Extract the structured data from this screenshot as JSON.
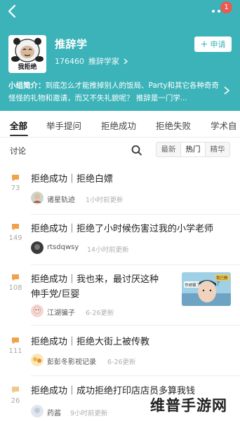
{
  "header": {
    "group_name": "推辞学",
    "member_count": "176460",
    "member_label": "推辞学家",
    "join_label": "申请",
    "avatar_caption": "我拒绝",
    "notification_count": "1",
    "intro_label": "小组简介：",
    "intro_text": "到底怎么才能推掉别人的饭局、Party和其它各种奇奇怪怪的礼物和邀请，而又不失礼貌呢？ 推辞是一门学...",
    "colors": {
      "brand": "#3cb3b9",
      "badge": "#e95a52"
    }
  },
  "tabs": [
    "全部",
    "举手提问",
    "拒绝成功",
    "拒绝失败",
    "学术自"
  ],
  "toolbar": {
    "title": "讨论",
    "sort_options": [
      "最新",
      "热门",
      "精华"
    ],
    "active_sort": "热门"
  },
  "posts": [
    {
      "replies": "73",
      "title_lines": [
        "拒绝成功｜拒绝白嫖"
      ],
      "author": "诸星轨迹",
      "time": "1小时前更新"
    },
    {
      "replies": "149",
      "title_lines": [
        "拒绝成功｜拒绝了小时候伤害过我的小学老师"
      ],
      "author": "rtsdqwsy",
      "time": "14小时前更新"
    },
    {
      "replies": "108",
      "title_lines": [
        "拒绝成功｜我也来，最讨厌这种",
        "伸手党/巨婴"
      ],
      "author": "江湖骗子",
      "time": "6-26更新",
      "thumb_labels": [
        "你被骗了",
        "我已删了"
      ]
    },
    {
      "replies": "111",
      "title_lines": [
        "拒绝成功｜拒绝大街上被传教"
      ],
      "author": "彭彭冬影视记录",
      "time": "6-26更新"
    },
    {
      "replies": "26",
      "title_lines": [
        "拒绝成功｜成功拒绝打印店店员多算我钱"
      ],
      "author": "药酱",
      "time": "9小时前更新"
    }
  ],
  "watermark": "维普手游网"
}
